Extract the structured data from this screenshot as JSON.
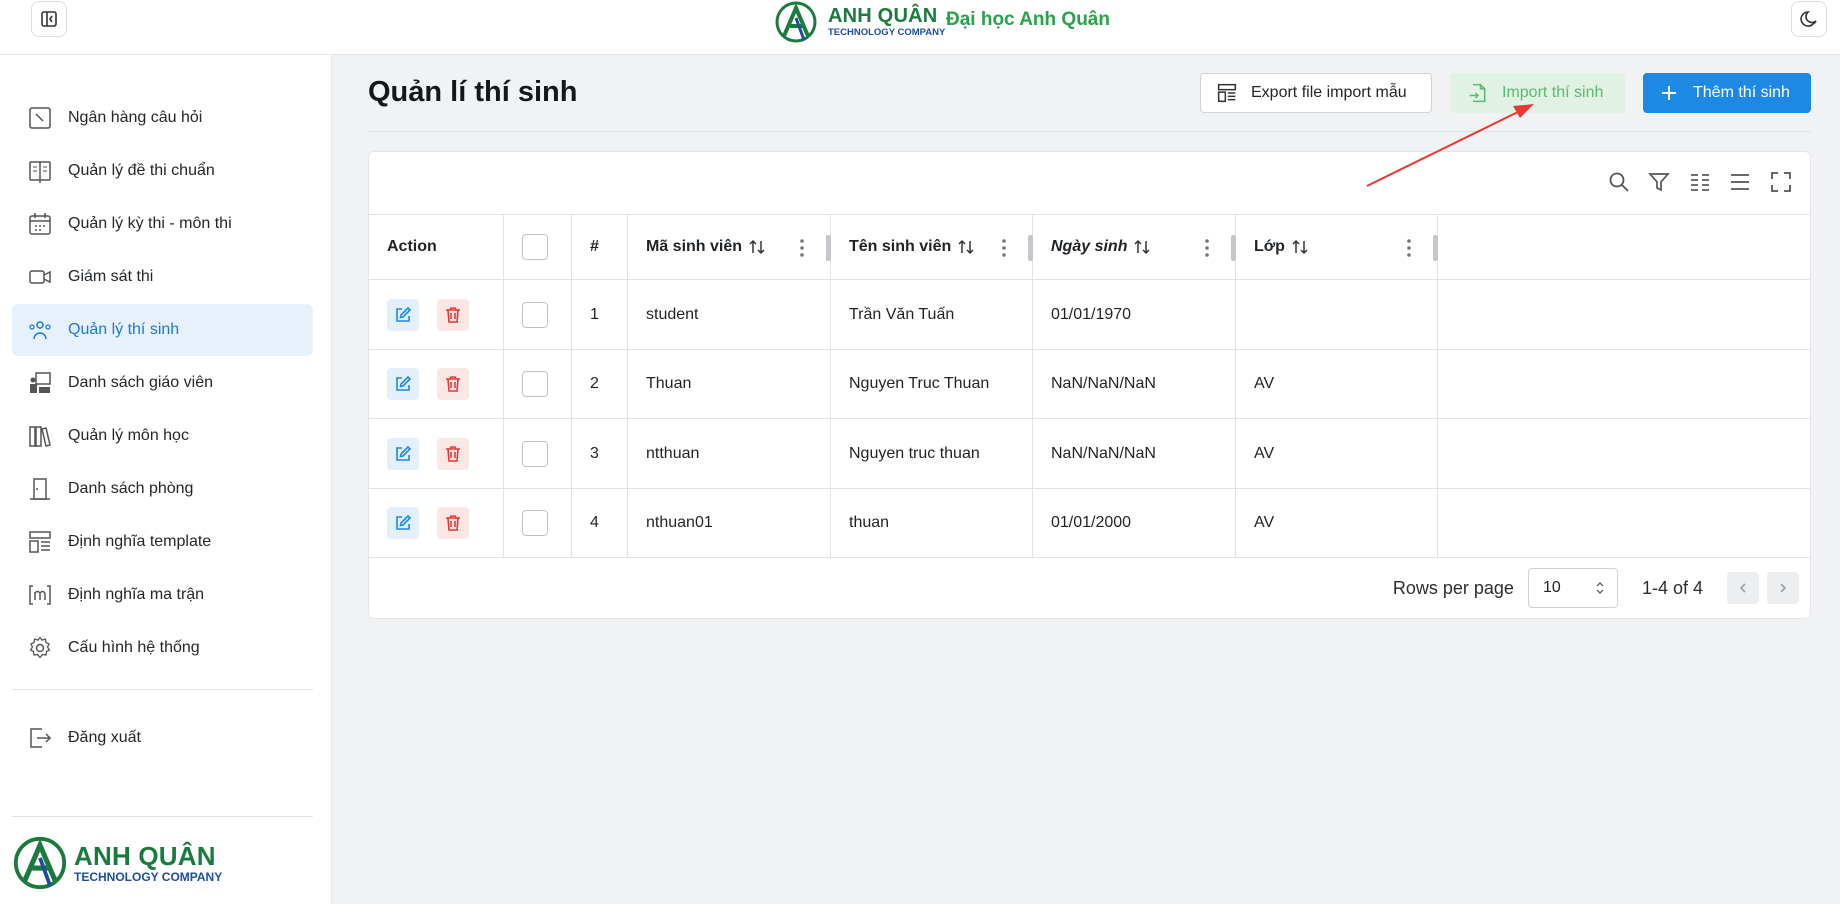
{
  "brand": {
    "name": "ANH QUÂN",
    "sub": "TECHNOLOGY COMPANY",
    "university": "Đại học Anh Quân"
  },
  "sidebar": {
    "items": [
      {
        "label": "Ngân hàng câu hỏi",
        "icon": "question-bank-icon"
      },
      {
        "label": "Quản lý đề thi chuẩn",
        "icon": "book-icon"
      },
      {
        "label": "Quản lý kỳ thi - môn thi",
        "icon": "calendar-icon"
      },
      {
        "label": "Giám sát thi",
        "icon": "video-icon"
      },
      {
        "label": "Quản lý thí sinh",
        "icon": "users-icon",
        "active": true
      },
      {
        "label": "Danh sách giáo viên",
        "icon": "teacher-icon"
      },
      {
        "label": "Quản lý môn học",
        "icon": "books-icon"
      },
      {
        "label": "Danh sách phòng",
        "icon": "door-icon"
      },
      {
        "label": "Định nghĩa template",
        "icon": "template-icon"
      },
      {
        "label": "Định nghĩa ma trận",
        "icon": "matrix-icon"
      },
      {
        "label": "Cấu hình hệ thống",
        "icon": "gear-icon"
      }
    ],
    "logout": "Đăng xuất"
  },
  "page": {
    "title": "Quản lí thí sinh"
  },
  "toolbar": {
    "export_label": "Export file import mẫu",
    "import_label": "Import thí sinh",
    "add_label": "Thêm thí sinh"
  },
  "table": {
    "columns": [
      "Action",
      "#",
      "Mã sinh viên",
      "Tên sinh viên",
      "Ngày sinh",
      "Lớp"
    ],
    "rows": [
      {
        "index": "1",
        "student_id": "student",
        "name": "Trần Văn Tuấn",
        "dob": "01/01/1970",
        "class": ""
      },
      {
        "index": "2",
        "student_id": "Thuan",
        "name": "Nguyen Truc Thuan",
        "dob": "NaN/NaN/NaN",
        "class": "AV"
      },
      {
        "index": "3",
        "student_id": "ntthuan",
        "name": "Nguyen truc thuan",
        "dob": "NaN/NaN/NaN",
        "class": "AV"
      },
      {
        "index": "4",
        "student_id": "nthuan01",
        "name": "thuan",
        "dob": "01/01/2000",
        "class": "AV"
      }
    ]
  },
  "pagination": {
    "rows_per_page_label": "Rows per page",
    "rows_per_page": "10",
    "range": "1-4 of 4"
  },
  "colors": {
    "accent": "#1e88e5",
    "import_bg": "#dff2e3",
    "import_text": "#5cb96f",
    "active_nav_bg": "#e6f1fb",
    "arrow": "#e53935"
  }
}
